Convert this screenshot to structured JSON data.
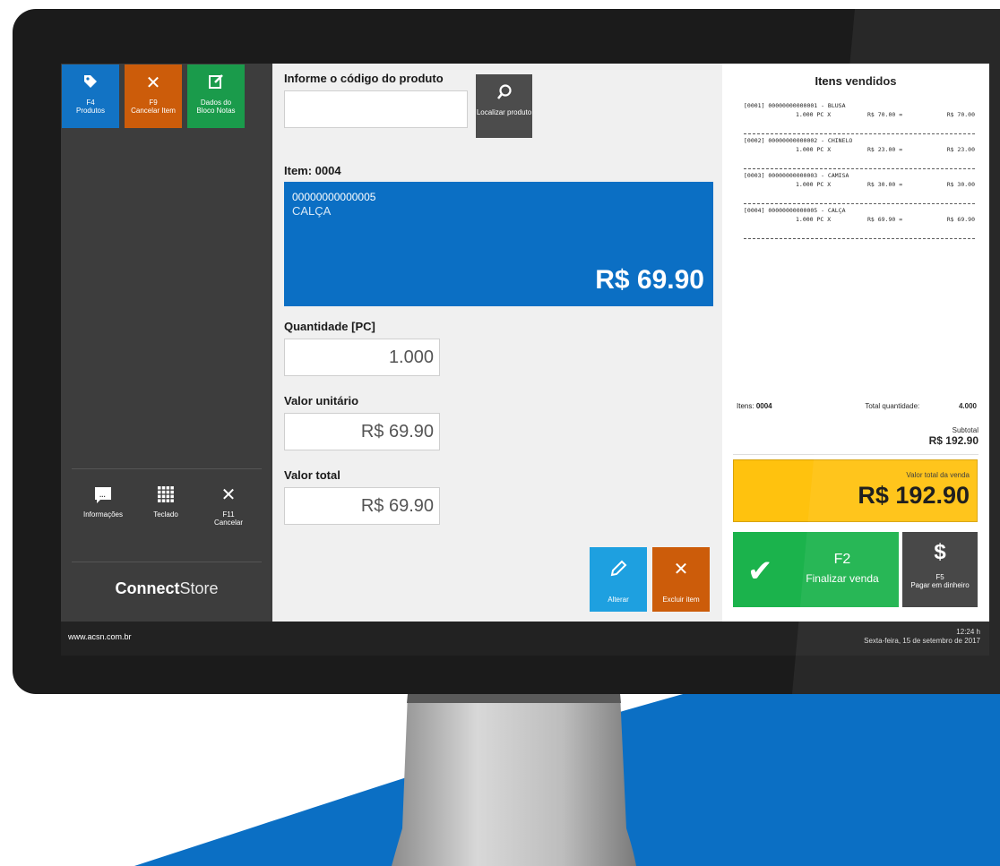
{
  "colors": {
    "accent_blue": "#0b6fc4",
    "orange": "#cc5c0a",
    "green": "#1bb34c",
    "yellow": "#ffc20e",
    "dark": "#3d3d3d"
  },
  "sidebar": {
    "tiles": [
      {
        "key": "F4",
        "label": "Produtos",
        "icon": "tag-icon"
      },
      {
        "key": "F9",
        "label": "Cancelar Item",
        "icon": "close-icon"
      },
      {
        "key": "",
        "label": "Dados do Bloco Notas",
        "icon": "edit-icon"
      }
    ],
    "bottom": [
      {
        "label": "Informações",
        "icon": "chat-icon"
      },
      {
        "label": "Teclado",
        "icon": "keypad-icon"
      },
      {
        "key": "F11",
        "label": "Cancelar",
        "icon": "close-icon"
      }
    ],
    "brand_bold": "Connect",
    "brand_light": "Store"
  },
  "center": {
    "code_label": "Informe o código do produto",
    "code_value": "",
    "locate_label": "Localizar produto",
    "item_label": "Item: 0004",
    "item_code": "00000000000005",
    "item_name": "CALÇA",
    "item_price": "R$ 69.90",
    "qty_label": "Quantidade [PC]",
    "qty_value": "1.000",
    "unit_label": "Valor unitário",
    "unit_value": "R$ 69.90",
    "total_label": "Valor total",
    "total_value": "R$ 69.90",
    "edit_label": "Alterar",
    "delete_label": "Excluir item"
  },
  "receipt": {
    "title": "Itens vendidos",
    "items": [
      {
        "line": "[0001] 00000000000001 - BLUSA",
        "qty": "1.000 PC X",
        "unit": "R$ 70.00 =",
        "total": "R$ 70.00"
      },
      {
        "line": "[0002] 00000000000002 - CHINELO",
        "qty": "1.000 PC X",
        "unit": "R$ 23.00 =",
        "total": "R$ 23.00"
      },
      {
        "line": "[0003] 00000000000003 - CAMISA",
        "qty": "1.000 PC X",
        "unit": "R$ 30.00 =",
        "total": "R$ 30.00"
      },
      {
        "line": "[0004] 00000000000005 - CALÇA",
        "qty": "1.000 PC X",
        "unit": "R$ 69.90 =",
        "total": "R$ 69.90"
      }
    ],
    "items_label": "Itens:",
    "items_count": "0004",
    "qty_total_label": "Total quantidade:",
    "qty_total": "4.000",
    "subtotal_label": "Subtotal",
    "subtotal": "R$ 192.90",
    "grand_label": "Valor total da venda",
    "grand_total": "R$ 192.90",
    "finish_key": "F2",
    "finish_label": "Finalizar venda",
    "cash_key": "F5",
    "cash_label": "Pagar em dinheiro"
  },
  "status": {
    "url": "www.acsn.com.br",
    "time": "12:24 h",
    "date": "Sexta-feira, 15 de setembro de 2017"
  }
}
